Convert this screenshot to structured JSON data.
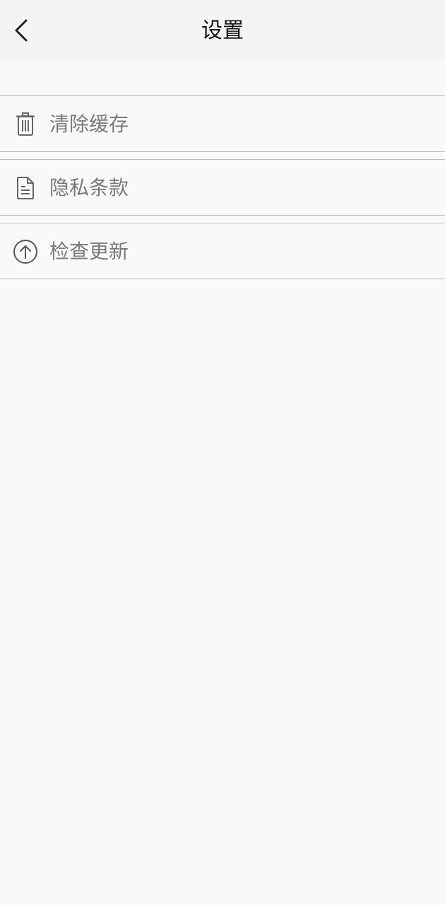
{
  "header": {
    "title": "设置",
    "back_icon": "chevron-left-icon"
  },
  "menu": [
    {
      "label": "清除缓存",
      "icon": "trash-icon"
    },
    {
      "label": "隐私条款",
      "icon": "document-icon"
    },
    {
      "label": "检查更新",
      "icon": "arrow-up-circle-icon"
    }
  ],
  "colors": {
    "background": "#f9f9f9",
    "header_background": "#f4f4f4",
    "divider": "#b9b9c6",
    "label_text": "#7a7a7a",
    "title_text": "#111111"
  }
}
